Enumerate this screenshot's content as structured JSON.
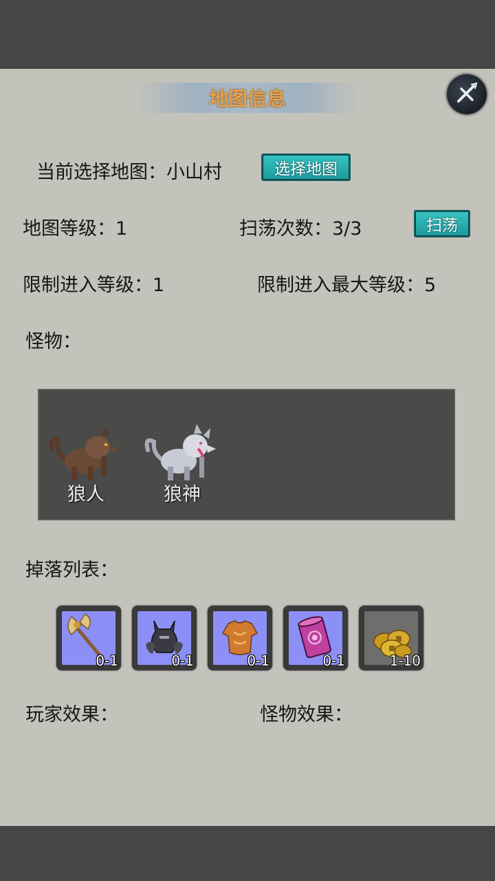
{
  "title": "地图信息",
  "current_map": {
    "label": "当前选择地图：小山村",
    "button": "选择地图"
  },
  "map_level": "地图等级：1",
  "sweep": {
    "label": "扫荡次数：3/3",
    "button": "扫荡"
  },
  "min_level": "限制进入等级：1",
  "max_level": "限制进入最大等级：5",
  "monsters_label": "怪物：",
  "monsters": [
    {
      "name": "狼人",
      "icon": "werewolf-icon"
    },
    {
      "name": "狼神",
      "icon": "wolf-god-icon"
    }
  ],
  "drops_label": "掉落列表：",
  "drops": [
    {
      "icon": "axe-icon",
      "count": "0-1"
    },
    {
      "icon": "helmet-icon",
      "count": "0-1"
    },
    {
      "icon": "armor-icon",
      "count": "0-1"
    },
    {
      "icon": "scroll-icon",
      "count": "0-1"
    },
    {
      "icon": "gold-coins-icon",
      "count": "1-10"
    }
  ],
  "player_effect_label": "玩家效果：",
  "monster_effect_label": "怪物效果：",
  "colors": {
    "teal_button": "#27b0b2",
    "title_text": "#e6a14a",
    "panel_bg": "#c3c2bb",
    "item_bg": "#8c8ff5"
  }
}
